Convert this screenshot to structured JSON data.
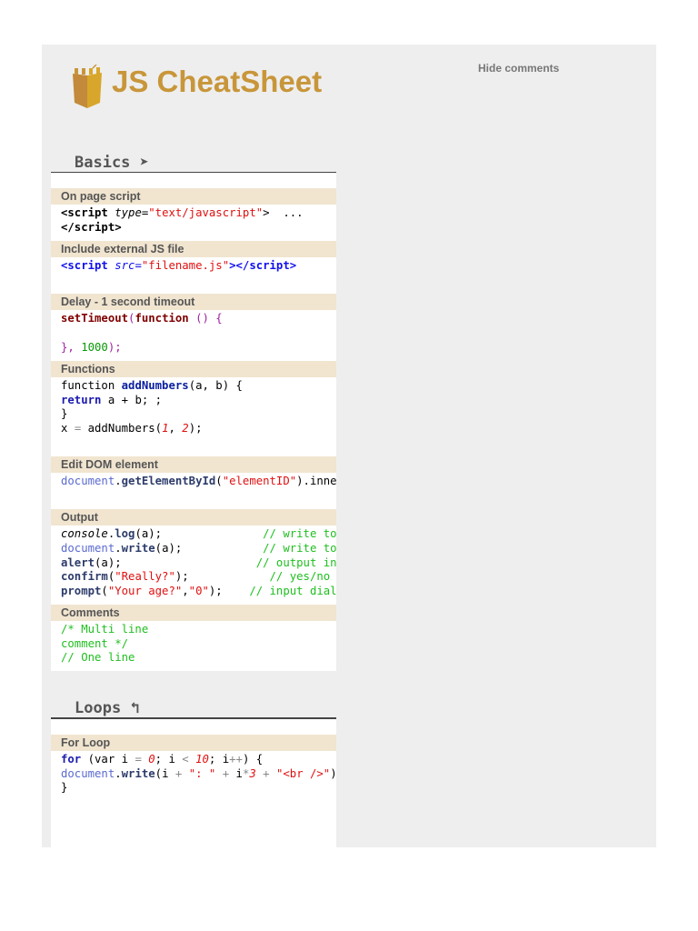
{
  "header": {
    "title": "JS CheatSheet",
    "hide_comments": "Hide comments"
  },
  "colors": {
    "brand": "#c8963a",
    "card_header": "#f1e5d0",
    "panel": "#eeeeee"
  },
  "sections": [
    {
      "title": "Basics",
      "icon": "➤",
      "cards": [
        {
          "title": "On page script",
          "lines": [
            [
              [
                "&lt;script ",
                "tag"
              ],
              [
                "type",
                "attr"
              ],
              [
                "=",
                ""
              ],
              [
                "\"text/javascript\"",
                "str"
              ],
              [
                "&gt;  ...",
                ""
              ]
            ],
            [
              [
                "&lt;/script&gt;",
                "tag"
              ]
            ]
          ]
        },
        {
          "title": "Include external JS file",
          "lines": [
            [
              [
                "<script ",
                "blueb"
              ],
              [
                "src",
                "blue attr"
              ],
              [
                "=",
                "blue"
              ],
              [
                "\"filename.js\"",
                "str"
              ],
              [
                "></script>",
                "blueb"
              ]
            ],
            []
          ]
        },
        {
          "title": "Delay - 1 second timeout",
          "lines": [
            [
              [
                "setTimeout",
                "dred"
              ],
              [
                "(",
                "purple"
              ],
              [
                "function",
                "dred"
              ],
              [
                " () {",
                "purple"
              ]
            ],
            [],
            [
              [
                "}, ",
                "purple"
              ],
              [
                "1000",
                "green"
              ],
              [
                ");",
                "purple"
              ]
            ]
          ]
        },
        {
          "title": "Functions",
          "lines": [
            [
              [
                "function ",
                ""
              ],
              [
                "addNumbers",
                "fn"
              ],
              [
                "(a, b) {",
                ""
              ]
            ],
            [
              [
                "return",
                "kw"
              ],
              [
                " a + b; ;",
                ""
              ]
            ],
            [
              [
                "}",
                ""
              ]
            ],
            [
              [
                "x ",
                ""
              ],
              [
                "=",
                "op"
              ],
              [
                " addNumbers(",
                ""
              ],
              [
                "1",
                "num"
              ],
              [
                ", ",
                ""
              ],
              [
                "2",
                "num"
              ],
              [
                ");",
                ""
              ]
            ],
            []
          ]
        },
        {
          "title": "Edit DOM element",
          "lines": [
            [
              [
                "document",
                "doc"
              ],
              [
                ".",
                ""
              ],
              [
                "getElementById",
                "meth"
              ],
              [
                "(",
                ""
              ],
              [
                "\"elementID\"",
                "str"
              ],
              [
                ").innerHTML",
                ""
              ]
            ],
            []
          ]
        },
        {
          "title": "Output",
          "lines": [
            [
              [
                "console",
                "it"
              ],
              [
                ".",
                ""
              ],
              [
                "log",
                "meth"
              ],
              [
                "(a);               ",
                ""
              ],
              [
                "// write to the browser console",
                "com"
              ]
            ],
            [
              [
                "document",
                "doc"
              ],
              [
                ".",
                ""
              ],
              [
                "write",
                "meth"
              ],
              [
                "(a);            ",
                ""
              ],
              [
                "// write to the HTML",
                "com"
              ]
            ],
            [
              [
                "alert",
                "meth"
              ],
              [
                "(a);                    ",
                ""
              ],
              [
                "// output in an alert box",
                "com"
              ]
            ],
            [
              [
                "confirm",
                "meth"
              ],
              [
                "(",
                ""
              ],
              [
                "\"Really?\"",
                "str"
              ],
              [
                ");            ",
                ""
              ],
              [
                "// yes/no dialog",
                "com"
              ]
            ],
            [
              [
                "prompt",
                "meth"
              ],
              [
                "(",
                ""
              ],
              [
                "\"Your age?\"",
                "str"
              ],
              [
                ",",
                ""
              ],
              [
                "\"0\"",
                "str"
              ],
              [
                ");    ",
                ""
              ],
              [
                "// input dialog",
                "com"
              ]
            ]
          ]
        },
        {
          "title": "Comments",
          "lines": [
            [
              [
                "/* Multi line",
                "com"
              ]
            ],
            [
              [
                "comment */",
                "com"
              ]
            ],
            [
              [
                "// One line",
                "com"
              ]
            ]
          ]
        }
      ]
    },
    {
      "title": "Loops",
      "icon": "↰",
      "cards": [
        {
          "title": "For Loop",
          "lines": [
            [
              [
                "for",
                "kw"
              ],
              [
                " (var i ",
                ""
              ],
              [
                "=",
                "op"
              ],
              [
                " ",
                ""
              ],
              [
                "0",
                "num"
              ],
              [
                "; i ",
                ""
              ],
              [
                "<",
                "op"
              ],
              [
                " ",
                ""
              ],
              [
                "10",
                "num"
              ],
              [
                "; i",
                ""
              ],
              [
                "++",
                "op"
              ],
              [
                ") {",
                ""
              ]
            ],
            [
              [
                "document",
                "doc"
              ],
              [
                ".",
                ""
              ],
              [
                "write",
                "meth"
              ],
              [
                "(i ",
                ""
              ],
              [
                "+",
                "op"
              ],
              [
                " ",
                ""
              ],
              [
                "\": \"",
                "str"
              ],
              [
                " ",
                ""
              ],
              [
                "+",
                "op"
              ],
              [
                " i",
                ""
              ],
              [
                "*",
                "op"
              ],
              [
                "3",
                "num"
              ],
              [
                " ",
                ""
              ],
              [
                "+",
                "op"
              ],
              [
                " ",
                ""
              ],
              [
                "\"<br />\"",
                "str"
              ],
              [
                ");",
                ""
              ]
            ],
            [
              [
                "}",
                ""
              ]
            ]
          ]
        }
      ]
    }
  ]
}
